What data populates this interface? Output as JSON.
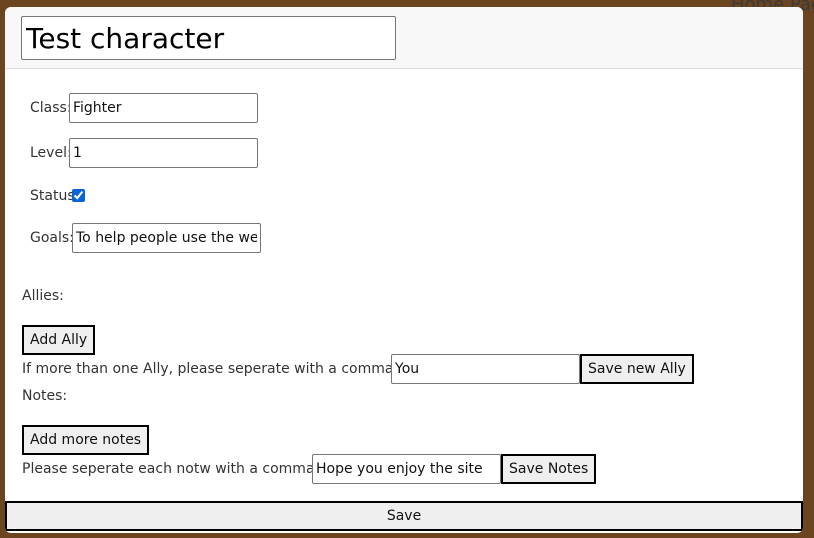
{
  "background": {
    "home_page_text": "Home Page"
  },
  "modal": {
    "title_value": "Test character",
    "class": {
      "label": "Class:",
      "value": "Fighter"
    },
    "level": {
      "label": "Level:",
      "value": "1"
    },
    "status": {
      "label": "Status",
      "checked": true
    },
    "goals": {
      "label": "Goals:",
      "value": "To help people use the website"
    },
    "allies": {
      "label": "Allies:",
      "add_button": "Add Ally",
      "hint": "If more than one Ally, please seperate with a comma",
      "input_value": "You",
      "save_button": "Save new Ally"
    },
    "notes": {
      "label": "Notes:",
      "add_button": "Add more notes",
      "hint": "Please seperate each notw with a comma",
      "input_value": "Hope you enjoy the site",
      "save_button": "Save Notes"
    },
    "save_label": "Save"
  },
  "colors": {
    "page_background": "#6b4420",
    "checkbox_accent": "#0a64d8"
  }
}
